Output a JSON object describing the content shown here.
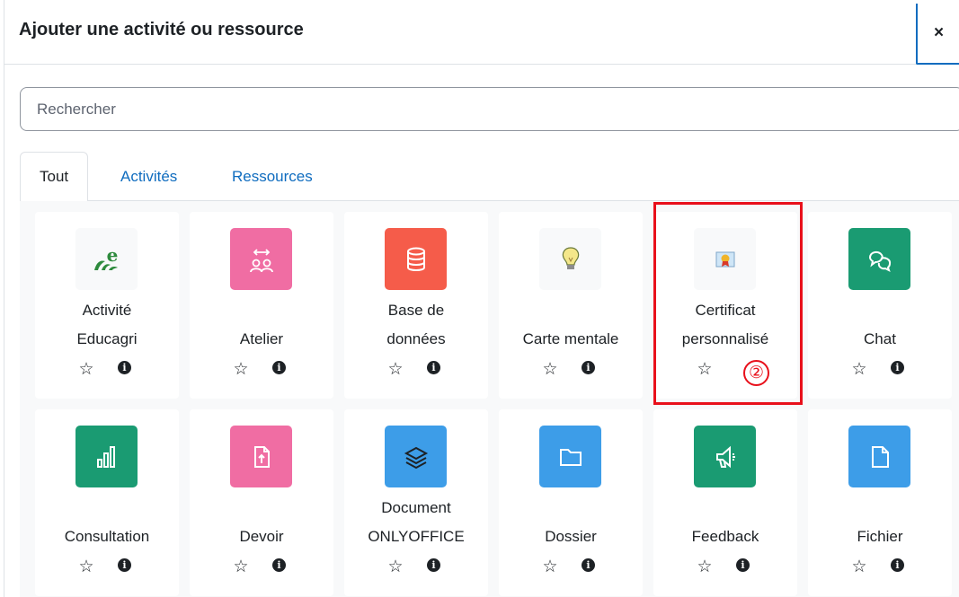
{
  "dialog": {
    "title": "Ajouter une activité ou ressource",
    "close_label": "×"
  },
  "search": {
    "placeholder": "Rechercher",
    "value": ""
  },
  "tabs": [
    {
      "label": "Tout",
      "active": true
    },
    {
      "label": "Activités",
      "active": false
    },
    {
      "label": "Ressources",
      "active": false
    }
  ],
  "modules": [
    {
      "name": "activite-educagri",
      "line1": "Activité",
      "line2": "Educagri",
      "icon": "educagri-icon",
      "color": "#f8f9fa"
    },
    {
      "name": "atelier",
      "line1": "",
      "line2": "Atelier",
      "icon": "workshop-icon",
      "color": "#f06da3"
    },
    {
      "name": "base-de-donnees",
      "line1": "Base de",
      "line2": "données",
      "icon": "database-icon",
      "color": "#f55c4a"
    },
    {
      "name": "carte-mentale",
      "line1": "",
      "line2": "Carte mentale",
      "icon": "lightbulb-icon",
      "color": "#f8f9fa"
    },
    {
      "name": "certificat-personnalise",
      "line1": "Certificat",
      "line2": "personnalisé",
      "icon": "certificate-icon",
      "color": "#f8f9fa"
    },
    {
      "name": "chat",
      "line1": "",
      "line2": "Chat",
      "icon": "chat-icon",
      "color": "#1a9b72"
    },
    {
      "name": "consultation",
      "line1": "",
      "line2": "Consultation",
      "icon": "bar-chart-icon",
      "color": "#1a9b72"
    },
    {
      "name": "devoir",
      "line1": "",
      "line2": "Devoir",
      "icon": "file-upload-icon",
      "color": "#f06da3"
    },
    {
      "name": "document-onlyoffice",
      "line1": "Document",
      "line2": "ONLYOFFICE",
      "icon": "layers-icon",
      "color": "#3d9de8"
    },
    {
      "name": "dossier",
      "line1": "",
      "line2": "Dossier",
      "icon": "folder-icon",
      "color": "#3d9de8"
    },
    {
      "name": "feedback",
      "line1": "",
      "line2": "Feedback",
      "icon": "megaphone-icon",
      "color": "#1a9b72"
    },
    {
      "name": "fichier",
      "line1": "",
      "line2": "Fichier",
      "icon": "file-icon",
      "color": "#3d9de8"
    }
  ],
  "step_marker": "②",
  "highlight_color": "#e8101b",
  "star_glyph": "☆",
  "info_glyph": "i"
}
